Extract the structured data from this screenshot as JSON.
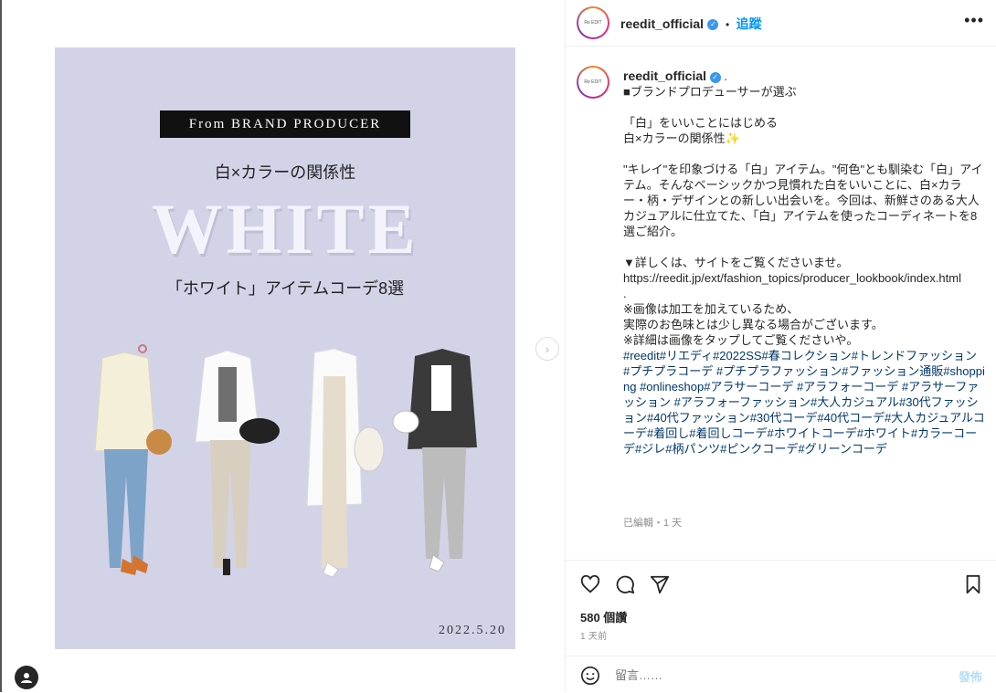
{
  "post": {
    "badge": "From BRAND PRODUCER",
    "subtitle": "白×カラーの関係性",
    "big_word": "WHITE",
    "tagline": "「ホワイト」アイテムコーデ8選",
    "date": "2022.5.20"
  },
  "header": {
    "username": "reedit_official",
    "separator": "•",
    "follow_label": "追蹤",
    "more": "•••",
    "avatar_text": "Re EDIT"
  },
  "caption": {
    "username": "reedit_official",
    "dot": ".",
    "body": "■ブランドプロデューサーが選ぶ\n\n「白」をいいことにはじめる\n白×カラーの関係性✨\n\n\"キレイ\"を印象づける「白」アイテム。\"何色\"とも馴染む「白」アイテム。そんなベーシックかつ見慣れた白をいいことに、白×カラー・柄・デザインとの新しい出会いを。今回は、新鮮さのある大人カジュアルに仕立てた、「白」アイテムを使ったコーディネートを8選ご紹介。\n\n▼詳しくは、サイトをご覧くださいませ。\nhttps://reedit.jp/ext/fashion_topics/producer_lookbook/index.html\n.\n※画像は加工を加えているため、\n実際のお色味とは少し異なる場合がございます。\n※詳細は画像をタップしてご覧くださいや。\n",
    "hashtags": "#reedit#リエディ#2022SS#春コレクション#トレンドファッション #プチプラコーデ #プチプラファッション#ファッション通販#shopping #onlineshop#アラサーコーデ #アラフォーコーデ #アラサーファッション #アラフォーファッション#大人カジュアル#30代ファッション#40代ファッション#30代コーデ#40代コーデ#大人カジュアルコーデ#着回し#着回しコーデ#ホワイトコーデ#ホワイト#カラーコーデ#ジレ#柄パンツ#ピンクコーデ#グリーンコーデ",
    "meta": "已編輯・1 天"
  },
  "stats": {
    "likes": "580 個讚",
    "ago": "1 天前"
  },
  "comment": {
    "placeholder": "留言……",
    "post_label": "發佈"
  },
  "colors": {
    "poster_bg": "#d3d3e8",
    "link": "#0095f6",
    "hashtag": "#00376b"
  }
}
